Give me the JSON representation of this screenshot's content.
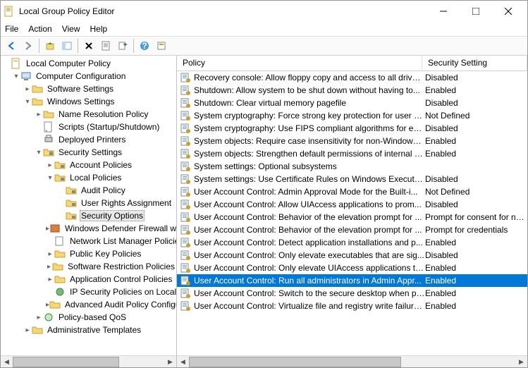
{
  "window": {
    "title": "Local Group Policy Editor"
  },
  "menu": {
    "file": "File",
    "action": "Action",
    "view": "View",
    "help": "Help"
  },
  "tree": {
    "root": "Local Computer Policy",
    "computer_config": "Computer Configuration",
    "software_settings": "Software Settings",
    "windows_settings": "Windows Settings",
    "name_resolution": "Name Resolution Policy",
    "scripts": "Scripts (Startup/Shutdown)",
    "deployed_printers": "Deployed Printers",
    "security_settings": "Security Settings",
    "account_policies": "Account Policies",
    "local_policies": "Local Policies",
    "audit_policy": "Audit Policy",
    "user_rights": "User Rights Assignment",
    "security_options": "Security Options",
    "windows_defender": "Windows Defender Firewall with Advanced Security",
    "network_list": "Network List Manager Policies",
    "public_key": "Public Key Policies",
    "software_restriction": "Software Restriction Policies",
    "app_control": "Application Control Policies",
    "ip_security": "IP Security Policies on Local Computer",
    "advanced_audit": "Advanced Audit Policy Configuration",
    "policy_qos": "Policy-based QoS",
    "admin_templates": "Administrative Templates"
  },
  "list_header": {
    "policy": "Policy",
    "setting": "Security Setting"
  },
  "policies": [
    {
      "name": "Recovery console: Allow floppy copy and access to all drives...",
      "setting": "Disabled"
    },
    {
      "name": "Shutdown: Allow system to be shut down without having to...",
      "setting": "Enabled"
    },
    {
      "name": "Shutdown: Clear virtual memory pagefile",
      "setting": "Disabled"
    },
    {
      "name": "System cryptography: Force strong key protection for user k...",
      "setting": "Not Defined"
    },
    {
      "name": "System cryptography: Use FIPS compliant algorithms for en...",
      "setting": "Disabled"
    },
    {
      "name": "System objects: Require case insensitivity for non-Windows ...",
      "setting": "Enabled"
    },
    {
      "name": "System objects: Strengthen default permissions of internal s...",
      "setting": "Enabled"
    },
    {
      "name": "System settings: Optional subsystems",
      "setting": ""
    },
    {
      "name": "System settings: Use Certificate Rules on Windows Executab...",
      "setting": "Disabled"
    },
    {
      "name": "User Account Control: Admin Approval Mode for the Built-i...",
      "setting": "Not Defined"
    },
    {
      "name": "User Account Control: Allow UIAccess applications to prom...",
      "setting": "Disabled"
    },
    {
      "name": "User Account Control: Behavior of the elevation prompt for ...",
      "setting": "Prompt for consent for non-Windows binaries"
    },
    {
      "name": "User Account Control: Behavior of the elevation prompt for ...",
      "setting": "Prompt for credentials"
    },
    {
      "name": "User Account Control: Detect application installations and p...",
      "setting": "Enabled"
    },
    {
      "name": "User Account Control: Only elevate executables that are sig...",
      "setting": "Disabled"
    },
    {
      "name": "User Account Control: Only elevate UIAccess applications th...",
      "setting": "Enabled"
    },
    {
      "name": "User Account Control: Run all administrators in Admin Appr...",
      "setting": "Enabled",
      "selected": true
    },
    {
      "name": "User Account Control: Switch to the secure desktop when pr...",
      "setting": "Enabled"
    },
    {
      "name": "User Account Control: Virtualize file and registry write failure...",
      "setting": "Enabled"
    }
  ]
}
